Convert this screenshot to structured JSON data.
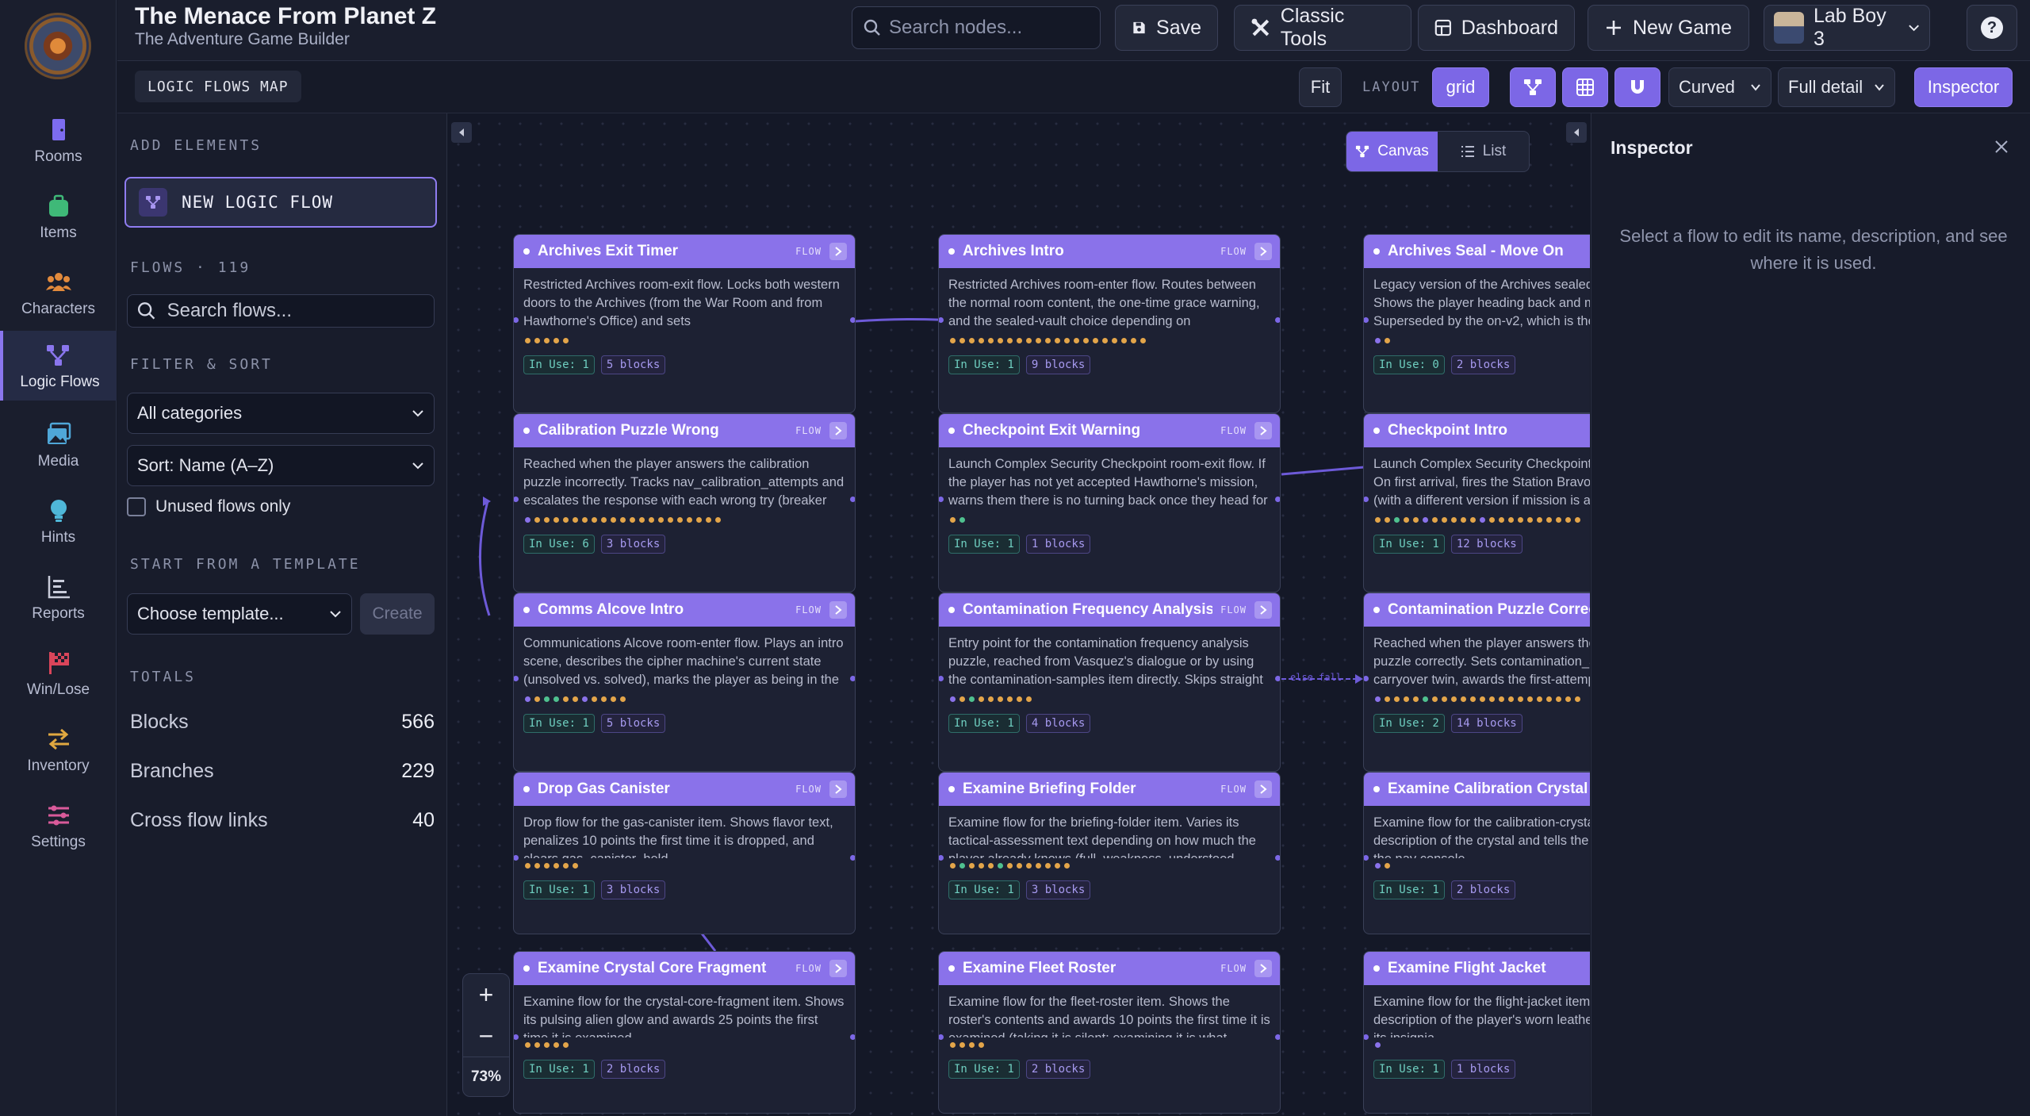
{
  "app": {
    "title": "The Menace From Planet Z",
    "subtitle": "The Adventure Game Builder"
  },
  "topbar": {
    "search_placeholder": "Search nodes...",
    "save_label": "Save",
    "classic_tools_label": "Classic Tools",
    "dashboard_label": "Dashboard",
    "new_game_label": "New Game",
    "user_label": "Lab Boy 3",
    "help_label": "?"
  },
  "rail": {
    "items": [
      {
        "label": "Rooms",
        "icon": "door-icon"
      },
      {
        "label": "Items",
        "icon": "bag-icon"
      },
      {
        "label": "Characters",
        "icon": "people-icon"
      },
      {
        "label": "Logic Flows",
        "icon": "flow-icon"
      },
      {
        "label": "Media",
        "icon": "image-icon"
      },
      {
        "label": "Hints",
        "icon": "bulb-icon"
      },
      {
        "label": "Reports",
        "icon": "chart-icon"
      },
      {
        "label": "Win/Lose",
        "icon": "flag-icon"
      },
      {
        "label": "Inventory",
        "icon": "swap-icon"
      },
      {
        "label": "Settings",
        "icon": "sliders-icon"
      }
    ],
    "active": "Logic Flows",
    "accent": "#8a76ee"
  },
  "toolbar": {
    "map_label": "LOGIC FLOWS MAP",
    "fit_label": "Fit",
    "layout_label": "LAYOUT",
    "layout_value": "grid",
    "edge_style": "Curved",
    "detail": "Full detail",
    "inspector_label": "Inspector"
  },
  "panel": {
    "add_heading": "ADD ELEMENTS",
    "new_flow_label": "NEW LOGIC FLOW",
    "flows_heading": "FLOWS · 119",
    "search_placeholder": "Search flows...",
    "filter_heading": "FILTER & SORT",
    "category": "All categories",
    "sort": "Sort: Name (A–Z)",
    "unused_label": "Unused flows only",
    "template_heading": "START FROM A TEMPLATE",
    "template_placeholder": "Choose template...",
    "create_label": "Create",
    "totals_heading": "TOTALS",
    "totals": [
      {
        "label": "Blocks",
        "value": "566"
      },
      {
        "label": "Branches",
        "value": "229"
      },
      {
        "label": "Cross flow links",
        "value": "40"
      }
    ]
  },
  "canvas": {
    "canvas_tab": "Canvas",
    "list_tab": "List",
    "zoom": "73%",
    "flow_tag": "FLOW",
    "edge_label": "else fall"
  },
  "nodes": [
    {
      "title": "Archives Exit Timer",
      "desc": "Restricted Archives room-exit flow. Locks both western doors to the Archives (from the War Room and from Hawthorne's Office) and sets archives_sealed_permanently, permanently sealing the...",
      "in_use": "In Use: 1",
      "blocks": "5 blocks",
      "dots": [
        "#e3a54a",
        "#e3a54a",
        "#e3a54a",
        "#e3a54a",
        "#e3a54a"
      ]
    },
    {
      "title": "Archives Intro",
      "desc": "Restricted Archives room-enter flow. Routes between the normal room content, the one-time grace warning, and the sealed-vault choice depending on archives_sealed_permanently and...",
      "in_use": "In Use: 1",
      "blocks": "9 blocks",
      "dots": [
        "#e3a54a",
        "#e3a54a",
        "#e3a54a",
        "#e3a54a",
        "#e3a54a",
        "#e3a54a",
        "#e3a54a",
        "#e3a54a",
        "#e3a54a",
        "#e3a54a",
        "#e3a54a",
        "#e3a54a",
        "#e3a54a",
        "#e3a54a",
        "#e3a54a",
        "#e3a54a",
        "#e3a54a",
        "#e3a54a",
        "#e3a54a",
        "#e3a54a",
        "#e3a54a"
      ]
    },
    {
      "title": "Archives Seal - Move On",
      "desc": "Legacy version of the Archives sealed-vault choice. Shows the player heading back and moves them there. Superseded by the on-v2, which is the version actually wired up.",
      "in_use": "In Use: 0",
      "blocks": "2 blocks",
      "dots": [
        "#8a72ea",
        "#e3a54a"
      ]
    },
    {
      "title": "Calibration Puzzle Wrong",
      "desc": "Reached when the player answers the calibration puzzle incorrectly. Tracks nav_calibration_attempts and escalates the response with each wrong try (breaker trip, Sparky calling through the wall, Sparky walking the player...",
      "in_use": "In Use: 6",
      "blocks": "3 blocks",
      "dots": [
        "#8a72ea",
        "#e3a54a",
        "#e3a54a",
        "#e3a54a",
        "#e3a54a",
        "#e3a54a",
        "#e3a54a",
        "#e3a54a",
        "#e3a54a",
        "#e3a54a",
        "#e3a54a",
        "#e3a54a",
        "#e3a54a",
        "#e3a54a",
        "#e3a54a",
        "#e3a54a",
        "#e3a54a",
        "#e3a54a",
        "#e3a54a",
        "#e3a54a",
        "#e3a54a"
      ]
    },
    {
      "title": "Checkpoint Exit Warning",
      "desc": "Launch Complex Security Checkpoint room-exit flow. If the player has not yet accepted Hawthorne's mission, warns them there is no turning back once they head for the launch facility.",
      "in_use": "In Use: 1",
      "blocks": "1 blocks",
      "dots": [
        "#e3a54a",
        "#4fc08f"
      ]
    },
    {
      "title": "Checkpoint Intro",
      "desc": "Launch Complex Security Checkpoint room-enter flow. On first arrival, fires the Station Bravo event broadcast (with a different version if mission is already true) and sets station_bravo_aired.",
      "in_use": "In Use: 1",
      "blocks": "12 blocks",
      "dots": [
        "#e3a54a",
        "#e3a54a",
        "#4fc08f",
        "#e3a54a",
        "#e3a54a",
        "#8a72ea",
        "#e3a54a",
        "#e3a54a",
        "#e3a54a",
        "#e3a54a",
        "#e3a54a",
        "#8a72ea",
        "#e3a54a",
        "#e3a54a",
        "#e3a54a",
        "#e3a54a",
        "#e3a54a",
        "#e3a54a",
        "#e3a54a",
        "#e3a54a",
        "#e3a54a",
        "#e3a54a"
      ]
    },
    {
      "title": "Comms Alcove Intro",
      "desc": "Communications Alcove room-enter flow. Plays an intro scene, describes the cipher machine's current state (unsolved vs. solved), marks the player as being in the room, and flags whether Sparky's on-the-spot jam-repair...",
      "in_use": "In Use: 1",
      "blocks": "5 blocks",
      "dots": [
        "#8a72ea",
        "#e3a54a",
        "#4fc08f",
        "#4fc08f",
        "#e3a54a",
        "#e3a54a",
        "#8a72ea",
        "#e3a54a",
        "#e3a54a",
        "#e3a54a",
        "#e3a54a"
      ]
    },
    {
      "title": "Contamination Frequency Analysis",
      "desc": "Entry point for the contamination frequency analysis puzzle, reached from Vasquez's dialogue or by using the contamination-samples item directly. Skips straight to the solved state if contamination_analyzed is already true,...",
      "in_use": "In Use: 1",
      "blocks": "4 blocks",
      "dots": [
        "#8a72ea",
        "#e3a54a",
        "#4fc08f",
        "#e3a54a",
        "#e3a54a",
        "#e3a54a",
        "#e3a54a",
        "#e3a54a",
        "#e3a54a"
      ]
    },
    {
      "title": "Contamination Puzzle Correct",
      "desc": "Reached when the player answers the contamination puzzle correctly. Sets contamination_analyzed, carryover twin, awards the first-attempt bonus (Master Diagnostician) if this was try one, gives...",
      "in_use": "In Use: 2",
      "blocks": "14 blocks",
      "dots": [
        "#8a72ea",
        "#e3a54a",
        "#e3a54a",
        "#e3a54a",
        "#e3a54a",
        "#4fc08f",
        "#e3a54a",
        "#e3a54a",
        "#e3a54a",
        "#e3a54a",
        "#e3a54a",
        "#e3a54a",
        "#e3a54a",
        "#e3a54a",
        "#e3a54a",
        "#e3a54a",
        "#e3a54a",
        "#e3a54a",
        "#e3a54a",
        "#e3a54a",
        "#e3a54a",
        "#e3a54a"
      ]
    },
    {
      "title": "Drop Gas Canister",
      "desc": "Drop flow for the gas-canister item. Shows flavor text, penalizes 10 points the first time it is dropped, and clears gas_canister_held.",
      "in_use": "In Use: 1",
      "blocks": "3 blocks",
      "dots": [
        "#e3a54a",
        "#e3a54a",
        "#e3a54a",
        "#e3a54a",
        "#e3a54a",
        "#e3a54a"
      ]
    },
    {
      "title": "Examine Briefing Folder",
      "desc": "Examine flow for the briefing-folder item. Varies its tactical-assessment text depending on how much the player already knows (full_weakness_understood, transmission_decoded), and reveals a hidden security-...",
      "in_use": "In Use: 1",
      "blocks": "3 blocks",
      "dots": [
        "#e3a54a",
        "#4fc08f",
        "#e3a54a",
        "#e3a54a",
        "#e3a54a",
        "#4fc08f",
        "#e3a54a",
        "#e3a54a",
        "#e3a54a",
        "#e3a54a",
        "#e3a54a",
        "#e3a54a",
        "#e3a54a"
      ]
    },
    {
      "title": "Examine Calibration Crystal",
      "desc": "Examine flow for the calibration-crystal item. Gives a description of the crystal and tells the player how it fits the nav console.",
      "in_use": "In Use: 1",
      "blocks": "2 blocks",
      "dots": [
        "#8a72ea",
        "#e3a54a"
      ]
    },
    {
      "title": "Examine Crystal Core Fragment",
      "desc": "Examine flow for the crystal-core-fragment item. Shows its pulsing alien glow and awards 25 points the first time it is examined.",
      "in_use": "In Use: 1",
      "blocks": "2 blocks",
      "dots": [
        "#e3a54a",
        "#e3a54a",
        "#e3a54a",
        "#e3a54a",
        "#e3a54a"
      ]
    },
    {
      "title": "Examine Fleet Roster",
      "desc": "Examine flow for the fleet-roster item. Shows the roster's contents and awards 10 points the first time it is examined (taking it is silent; examining it is what scores).",
      "in_use": "In Use: 1",
      "blocks": "2 blocks",
      "dots": [
        "#e3a54a",
        "#e3a54a",
        "#e3a54a",
        "#e3a54a"
      ]
    },
    {
      "title": "Examine Flight Jacket",
      "desc": "Examine flow for the flight-jacket item. Gives a description of the player's worn leather flight jacket and its insignia.",
      "in_use": "In Use: 1",
      "blocks": "1 blocks",
      "dots": [
        "#8a72ea"
      ]
    }
  ],
  "inspector": {
    "title": "Inspector",
    "hint": "Select a flow to edit its name, description, and see where it is used."
  }
}
